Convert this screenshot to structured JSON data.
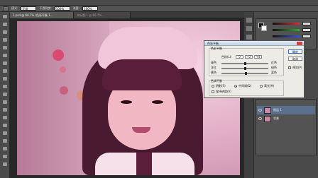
{
  "options_bar": {
    "label_1": "模式:",
    "field_1": "正常",
    "label_2": "不透明度:",
    "field_2": "100%",
    "label_3": "流量:",
    "field_3": "100%"
  },
  "tabs": [
    {
      "label": "1.psd @ 66.7% (色彩平衡 1...",
      "active": true
    },
    {
      "label": "未标题-1 @ 66.7%...",
      "active": false
    }
  ],
  "dialog": {
    "title": "色彩平衡",
    "group1_title": "色彩平衡",
    "levels_label": "色阶(L):",
    "levels": [
      "0",
      "+2",
      "+4"
    ],
    "sliders": [
      {
        "left": "青色",
        "right": "红色",
        "value_fraction": 0.5
      },
      {
        "left": "洋红",
        "right": "绿色",
        "value_fraction": 0.51
      },
      {
        "left": "黄色",
        "right": "蓝色",
        "value_fraction": 0.53
      }
    ],
    "group2_title": "色调平衡",
    "tones": [
      {
        "label": "阴影(S)",
        "checked": false
      },
      {
        "label": "中间调(D)",
        "checked": true
      },
      {
        "label": "高光(H)",
        "checked": false
      }
    ],
    "preserve_label": "保持明度(V)",
    "ok_label": "确定",
    "cancel_label": "取消",
    "preview_label": "预览(P)"
  },
  "layers": [
    {
      "name": "图层 1",
      "selected": true
    },
    {
      "name": "背景",
      "selected": false
    }
  ],
  "colors": {
    "red_bar": "#cc3333",
    "green_bar": "#33aa33",
    "blue_bar": "#3355cc",
    "accent": "#2c6fd6"
  }
}
